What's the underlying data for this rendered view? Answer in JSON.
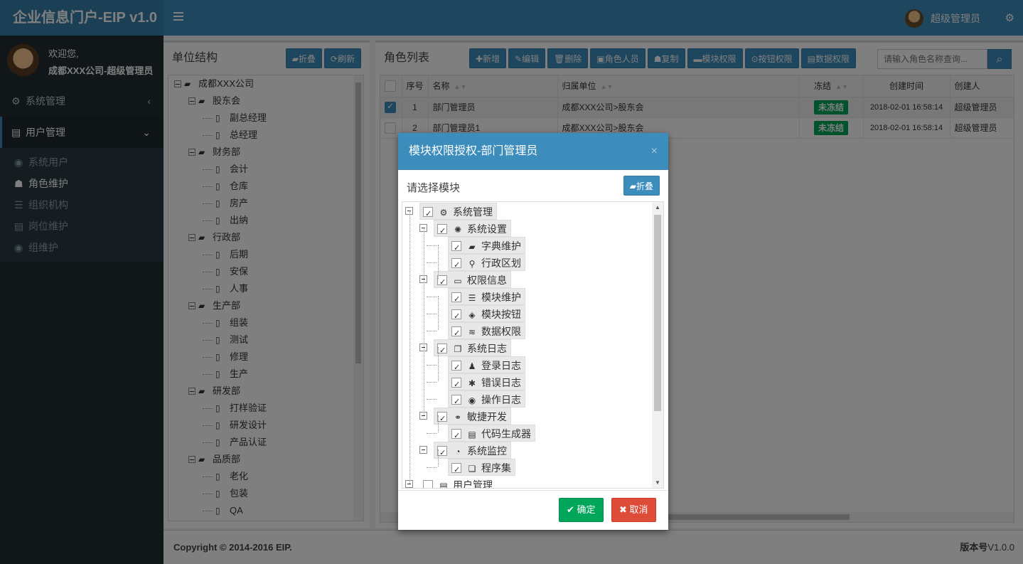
{
  "app": {
    "title": "企业信息门户-EIP v1.0"
  },
  "topbar": {
    "username": "超级管理员"
  },
  "user_panel": {
    "welcome": "欢迎您,",
    "name": "成都XXX公司-超级管理员"
  },
  "sidebar": {
    "items": [
      {
        "label": "系统管理",
        "icon": "gear-icon",
        "chevron": "‹"
      },
      {
        "label": "用户管理",
        "icon": "id-card-icon",
        "chevron": "⌄"
      }
    ],
    "sub_items": [
      {
        "label": "系统用户",
        "icon": "user-circle-icon"
      },
      {
        "label": "角色维护",
        "icon": "users-icon"
      },
      {
        "label": "组织机构",
        "icon": "list-icon"
      },
      {
        "label": "岗位维护",
        "icon": "id-card-icon"
      },
      {
        "label": "组维护",
        "icon": "user-circle-icon"
      }
    ]
  },
  "unit_panel": {
    "title": "单位结构",
    "fold_label": "折叠",
    "refresh_label": "刷新",
    "tree": [
      {
        "label": "成都XXX公司",
        "type": "folder"
      },
      {
        "label": "股东会",
        "type": "folder"
      },
      {
        "label": "副总经理",
        "type": "file"
      },
      {
        "label": "总经理",
        "type": "file"
      },
      {
        "label": "财务部",
        "type": "folder"
      },
      {
        "label": "会计",
        "type": "file"
      },
      {
        "label": "仓库",
        "type": "file"
      },
      {
        "label": "房产",
        "type": "file"
      },
      {
        "label": "出纳",
        "type": "file"
      },
      {
        "label": "行政部",
        "type": "folder"
      },
      {
        "label": "后期",
        "type": "file"
      },
      {
        "label": "安保",
        "type": "file"
      },
      {
        "label": "人事",
        "type": "file"
      },
      {
        "label": "生产部",
        "type": "folder"
      },
      {
        "label": "组装",
        "type": "file"
      },
      {
        "label": "测试",
        "type": "file"
      },
      {
        "label": "修理",
        "type": "file"
      },
      {
        "label": "生产",
        "type": "file"
      },
      {
        "label": "研发部",
        "type": "folder"
      },
      {
        "label": "打样验证",
        "type": "file"
      },
      {
        "label": "研发设计",
        "type": "file"
      },
      {
        "label": "产品认证",
        "type": "file"
      },
      {
        "label": "品质部",
        "type": "folder"
      },
      {
        "label": "老化",
        "type": "file"
      },
      {
        "label": "包装",
        "type": "file"
      },
      {
        "label": "QA",
        "type": "file"
      }
    ]
  },
  "role_panel": {
    "title": "角色列表",
    "buttons": [
      "新增",
      "编辑",
      "删除",
      "角色人员",
      "复制",
      "模块权限",
      "按钮权限",
      "数据权限"
    ],
    "search_placeholder": "请输入角色名称查询...",
    "columns": [
      "序号",
      "名称",
      "归属单位",
      "冻结",
      "创建时间",
      "创建人"
    ],
    "rows": [
      {
        "no": "1",
        "name": "部门管理员",
        "unit": "成都XXX公司>股东会",
        "frozen": "未冻结",
        "created": "2018-02-01 16:58:14",
        "creator": "超级管理员",
        "checked": true
      },
      {
        "no": "2",
        "name": "部门管理员1",
        "unit": "成都XXX公司>股东会",
        "frozen": "未冻结",
        "created": "2018-02-01 16:58:14",
        "creator": "超级管理员",
        "checked": false
      }
    ]
  },
  "footer": {
    "copyright": "Copyright © 2014-2016",
    "brand": "EIP.",
    "version_label": "版本号",
    "version": "V1.0.0"
  },
  "modal": {
    "title": "模块权限授权-部门管理员",
    "close": "×",
    "subtitle": "请选择模块",
    "fold_label": "折叠",
    "ok_label": "确定",
    "cancel_label": "取消",
    "tree": [
      {
        "label": "系统管理",
        "icon": "gear-icon",
        "level": 0,
        "checked": true
      },
      {
        "label": "系统设置",
        "icon": "cog-outline-icon",
        "level": 1,
        "checked": true
      },
      {
        "label": "字典维护",
        "icon": "book-icon",
        "level": 2,
        "checked": true
      },
      {
        "label": "行政区划",
        "icon": "map-pin-icon",
        "level": 2,
        "checked": true
      },
      {
        "label": "权限信息",
        "icon": "desktop-icon",
        "level": 1,
        "checked": true
      },
      {
        "label": "模块维护",
        "icon": "list-icon",
        "level": 2,
        "checked": true
      },
      {
        "label": "模块按钮",
        "icon": "cube-icon",
        "level": 2,
        "checked": true
      },
      {
        "label": "数据权限",
        "icon": "database-icon",
        "level": 2,
        "checked": true
      },
      {
        "label": "系统日志",
        "icon": "copy-icon",
        "level": 1,
        "checked": true
      },
      {
        "label": "登录日志",
        "icon": "person-icon",
        "level": 2,
        "checked": true
      },
      {
        "label": "错误日志",
        "icon": "bug-icon",
        "level": 2,
        "checked": true
      },
      {
        "label": "操作日志",
        "icon": "eye-icon",
        "level": 2,
        "checked": true
      },
      {
        "label": "敏捷开发",
        "icon": "handshake-icon",
        "level": 1,
        "checked": true
      },
      {
        "label": "代码生成器",
        "icon": "server-icon",
        "level": 2,
        "checked": true
      },
      {
        "label": "系统监控",
        "icon": "dashboard-icon",
        "level": 1,
        "checked": true
      },
      {
        "label": "程序集",
        "icon": "clone-icon",
        "level": 2,
        "checked": true
      },
      {
        "label": "用户管理",
        "icon": "id-card-icon",
        "level": 0,
        "checked": false
      }
    ]
  }
}
